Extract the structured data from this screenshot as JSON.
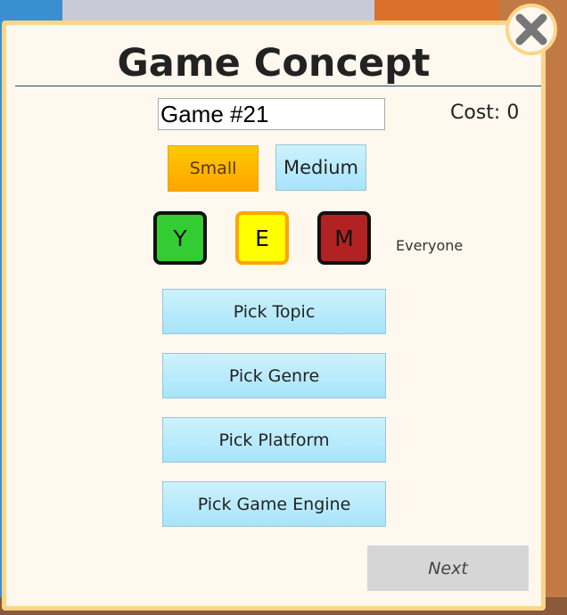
{
  "dialog": {
    "title": "Game Concept",
    "game_name_value": "Game #21",
    "cost_label": "Cost: 0",
    "sizes": [
      {
        "label": "Small",
        "selected": true
      },
      {
        "label": "Medium",
        "selected": false
      }
    ],
    "ratings": [
      {
        "label": "Y",
        "color": "#33cc33"
      },
      {
        "label": "E",
        "color": "#ffff00",
        "selected": true
      },
      {
        "label": "M",
        "color": "#b22222"
      }
    ],
    "rating_description": "Everyone",
    "pick_buttons": [
      "Pick Topic",
      "Pick Genre",
      "Pick Platform",
      "Pick Game Engine"
    ],
    "next_label": "Next",
    "close_icon": "close-x-icon"
  }
}
